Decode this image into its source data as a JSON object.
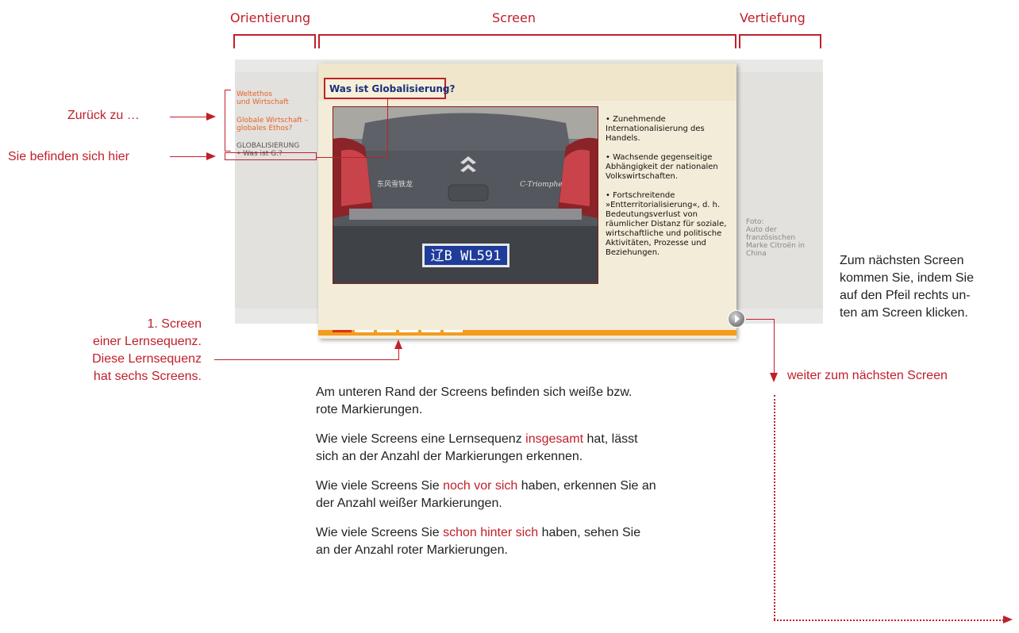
{
  "headers": {
    "orientation": "Orientierung",
    "screen": "Screen",
    "deepening": "Vertiefung"
  },
  "annotations": {
    "back_to": "Zurück zu …",
    "you_are_here": "Sie befinden sich hier",
    "first_screen": [
      "1. Screen",
      "einer Lernsequenz.",
      "Diese Lernsequenz",
      "hat sechs Screens."
    ],
    "next_screen_hint": [
      "Zum nächsten Screen",
      "kommen Sie, indem Sie",
      "auf den Pfeil rechts un-",
      "ten am Screen klicken."
    ],
    "next_screen_link": "weiter zum nächsten Screen"
  },
  "app": {
    "nav": {
      "items": [
        {
          "line1": "Weltethos",
          "line2": "und Wirtschaft"
        },
        {
          "line1": "Globale Wirtschaft –",
          "line2": "globales Ethos?"
        }
      ],
      "section": "GLOBALISIERUNG",
      "current": "• Was ist G.?"
    },
    "screen": {
      "title": "Was ist Globalisierung?",
      "bullets": [
        "• Zunehmende Internationalisierung des Handels.",
        "• Wachsende gegenseitige Abhängigkeit der nationalen Volkswirtschaften.",
        "• Fortschreitende »Entterritorialisierung«, d. h. Bedeutungsverlust von räumlicher Distanz für soziale, wirtschaftliche und politische Aktivitäten, Prozesse und Beziehungen."
      ],
      "plate": "辽B WL591",
      "car_left_badge": "东风雪铁龙",
      "car_right_badge": "C-Triomphe",
      "progress": {
        "total": 6,
        "completed": 1
      }
    },
    "photo_caption": "Foto:\nAuto der\nfranzösischen\nMarke Citroën in\nChina"
  },
  "explanation": {
    "p1": "Am unteren Rand der Screens befinden sich weiße bzw. rote Markierungen.",
    "p2_before": "Wie viele Screens eine Lernsequenz ",
    "p2_hl": "insgesamt",
    "p2_after": " hat, lässt sich an der Anzahl der Markierungen erkennen.",
    "p3_before": "Wie viele Screens Sie ",
    "p3_hl": "noch vor sich",
    "p3_after": " haben, erkennen Sie an der Anzahl weißer Markierungen.",
    "p4_before": "Wie viele Screens Sie ",
    "p4_hl": "schon hinter sich",
    "p4_after": " haben, sehen Sie an der Anzahl roter Markierungen."
  },
  "colors": {
    "accent": "#c0202a",
    "orange": "#f39c1e",
    "title_blue": "#1b2f7a"
  }
}
